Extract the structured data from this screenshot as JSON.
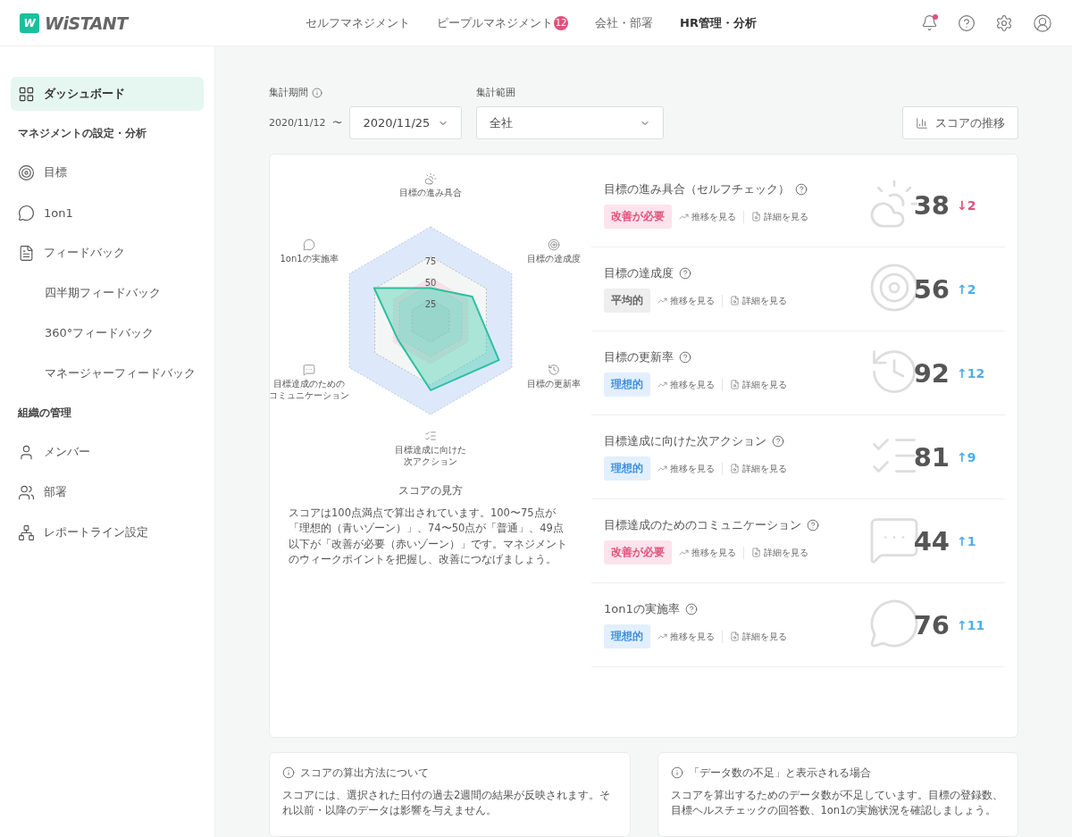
{
  "header": {
    "logo": {
      "mark": "W",
      "name": "WiSTANT"
    },
    "nav": [
      {
        "label": "セルフマネジメント",
        "selected": false
      },
      {
        "label": "ピープルマネジメント",
        "selected": false,
        "badge": "12"
      },
      {
        "label": "会社・部署",
        "selected": false
      },
      {
        "label": "HR管理・分析",
        "selected": true
      }
    ],
    "notification_dot": true
  },
  "sidebar": {
    "items": [
      {
        "kind": "item",
        "label": "ダッシュボード",
        "selected": true
      },
      {
        "kind": "section",
        "label": "マネジメントの設定・分析"
      },
      {
        "kind": "item",
        "label": "目標",
        "selected": false
      },
      {
        "kind": "item",
        "label": "1on1",
        "selected": false
      },
      {
        "kind": "item",
        "label": "フィードバック",
        "selected": false,
        "children": [
          {
            "label": "四半期フィードバック",
            "selected": false
          },
          {
            "label": "360°フィードバック",
            "selected": false
          },
          {
            "label": "マネージャーフィードバック",
            "selected": false
          }
        ]
      },
      {
        "kind": "section",
        "label": "組織の管理"
      },
      {
        "kind": "item",
        "label": "メンバー",
        "selected": false
      },
      {
        "kind": "item",
        "label": "部署",
        "selected": false
      },
      {
        "kind": "item",
        "label": "レポートライン設定",
        "selected": false
      }
    ]
  },
  "filters": {
    "period_label": "集計期間",
    "period_start": "2020/11/12",
    "separator": "〜",
    "period_end": "2020/11/25",
    "scope_label": "集計範囲",
    "scope": "全社",
    "trend_button": "スコアの推移"
  },
  "radar": {
    "ticks": [
      "75",
      "50",
      "25"
    ],
    "axes": [
      {
        "lines": [
          "目標の進み具合"
        ]
      },
      {
        "lines": [
          "1on1の実施率"
        ]
      },
      {
        "lines": [
          "目標の達成度"
        ]
      },
      {
        "lines": [
          "目標達成のための",
          "コミュニケーション"
        ]
      },
      {
        "lines": [
          "目標の更新率"
        ]
      },
      {
        "lines": [
          "目標達成に向けた",
          "次アクション"
        ]
      }
    ],
    "legend_title": "スコアの見方",
    "legend_text": "スコアは100点満点で算出されています。100〜75点が「理想的（青いゾーン）」、74〜50点が「普通」、49点以下が「改善が必要（赤いゾーン）」です。マネジメントのウィークポイントを把握し、改善につなげましょう。"
  },
  "metrics": [
    {
      "title": "目標の進み具合（セルフチェック）",
      "status": {
        "label": "改善が必要",
        "kind": "bad"
      },
      "trend_link": "推移を見る",
      "detail_link": "詳細を見る",
      "score": "38",
      "delta": {
        "arrow": "↓",
        "text": "2",
        "color": "#e0507a"
      }
    },
    {
      "title": "目標の達成度",
      "status": {
        "label": "平均的",
        "kind": "average"
      },
      "trend_link": "推移を見る",
      "detail_link": "詳細を見る",
      "score": "56",
      "delta": {
        "arrow": "↑",
        "text": "2",
        "color": "#4baee8"
      }
    },
    {
      "title": "目標の更新率",
      "status": {
        "label": "理想的",
        "kind": "ideal"
      },
      "trend_link": "推移を見る",
      "detail_link": "詳細を見る",
      "score": "92",
      "delta": {
        "arrow": "↑",
        "text": "12",
        "color": "#4baee8"
      }
    },
    {
      "title": "目標達成に向けた次アクション",
      "status": {
        "label": "理想的",
        "kind": "ideal"
      },
      "trend_link": "推移を見る",
      "detail_link": "詳細を見る",
      "score": "81",
      "delta": {
        "arrow": "↑",
        "text": "9",
        "color": "#4baee8"
      }
    },
    {
      "title": "目標達成のためのコミュニケーション",
      "status": {
        "label": "改善が必要",
        "kind": "bad"
      },
      "trend_link": "推移を見る",
      "detail_link": "詳細を見る",
      "score": "44",
      "delta": {
        "arrow": "↑",
        "text": "1",
        "color": "#4baee8"
      }
    },
    {
      "title": "1on1の実施率",
      "status": {
        "label": "理想的",
        "kind": "ideal"
      },
      "trend_link": "推移を見る",
      "detail_link": "詳細を見る",
      "score": "76",
      "delta": {
        "arrow": "↑",
        "text": "11",
        "color": "#4baee8"
      }
    }
  ],
  "notes": [
    {
      "title": "スコアの算出方法について",
      "text": "スコアには、選択された日付の過去2週間の結果が反映されます。それ以前・以降のデータは影響を与えません。"
    },
    {
      "title": "「データ数の不足」と表示される場合",
      "text": "スコアを算出するためのデータ数が不足しています。目標の登録数、目標ヘルスチェックの回答数、1on1の実施状況を確認しましょう。"
    }
  ]
}
